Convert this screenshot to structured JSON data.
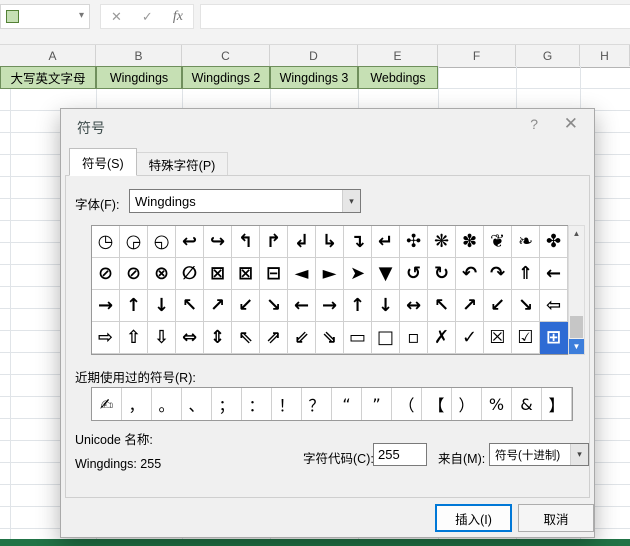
{
  "colors": {
    "accent": "#0078d7",
    "selection_blue": "#2e6bd4",
    "excel_green": "#217346",
    "cell_fill_green": "#c6e0b4"
  },
  "icons": {
    "dropdown": "▾",
    "scroll_up": "▲",
    "scroll_down": "▼",
    "formula_cancel": "✕",
    "formula_enter": "✓",
    "formula_fx": "fx",
    "dialog_help": "?",
    "dialog_close": "✕"
  },
  "excel": {
    "name_box_value": "",
    "columns": [
      "A",
      "B",
      "C",
      "D",
      "E",
      "F",
      "G",
      "H"
    ],
    "row1": [
      "大写英文字母",
      "Wingdings",
      "Wingdings 2",
      "Wingdings 3",
      "Webdings"
    ]
  },
  "dialog": {
    "title": "符号",
    "tabs": [
      {
        "label": "符号(S)",
        "active": true
      },
      {
        "label": "特殊字符(P)",
        "active": false
      }
    ],
    "font": {
      "label": "字体(F):",
      "value": "Wingdings"
    },
    "grid": {
      "rows": [
        [
          "◷",
          "◶",
          "◵",
          "↩",
          "↪",
          "↰",
          "↱",
          "↲",
          "↳",
          "↴",
          "↵",
          "✣",
          "❋",
          "✽",
          "❦",
          "❧",
          "✤"
        ],
        [
          "⊘",
          "⊘",
          "⊗",
          "∅",
          "⊠",
          "⊠",
          "⊟",
          "◄",
          "►",
          "➤",
          "▼",
          "↺",
          "↻",
          "↶",
          "↷",
          "⇑",
          "←"
        ],
        [
          "→",
          "↑",
          "↓",
          "↖",
          "↗",
          "↙",
          "↘",
          "←",
          "→",
          "↑",
          "↓",
          "↔",
          "↖",
          "↗",
          "↙",
          "↘",
          "⇦"
        ],
        [
          "⇨",
          "⇧",
          "⇩",
          "⇔",
          "⇕",
          "⇖",
          "⇗",
          "⇙",
          "⇘",
          "▭",
          "□",
          "▫",
          "✗",
          "✓",
          "☒",
          "☑",
          "⊞"
        ]
      ],
      "selected": {
        "row": 3,
        "col": 16
      }
    },
    "recent": {
      "label": "近期使用过的符号(R):",
      "symbols": [
        "✍",
        "，",
        "。",
        "、",
        "；",
        "：",
        "！",
        "？",
        "“",
        "”",
        "（",
        "【",
        "）",
        "%",
        "&",
        "】"
      ]
    },
    "unicode_name_label": "Unicode 名称:",
    "unicode_name_value": "Wingdings: 255",
    "char_code": {
      "label": "字符代码(C):",
      "value": "255"
    },
    "from": {
      "label": "来自(M):",
      "value": "符号(十进制)"
    },
    "buttons": {
      "insert": "插入(I)",
      "cancel": "取消"
    }
  }
}
